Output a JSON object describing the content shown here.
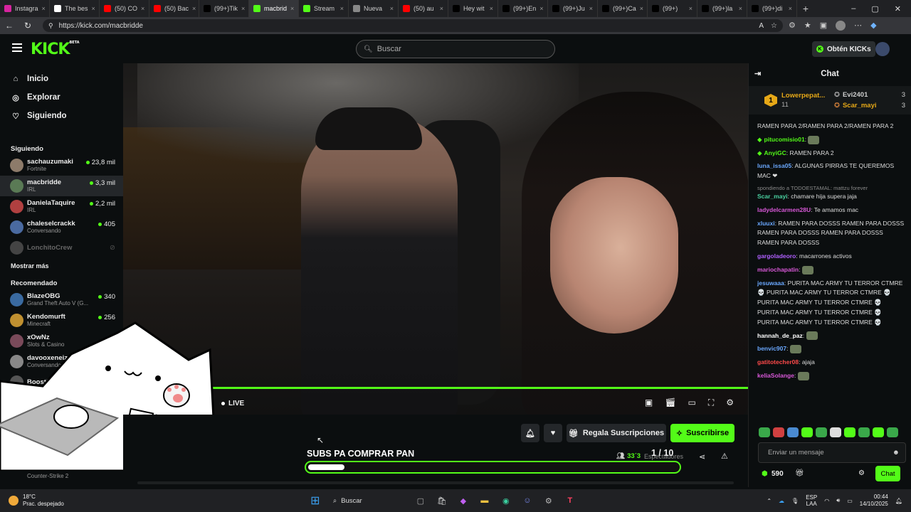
{
  "browser": {
    "tabs": [
      {
        "label": "Instagra",
        "icon_color": "#d6249f"
      },
      {
        "label": "The bes",
        "icon_color": "#ffffff"
      },
      {
        "label": "(50) CO",
        "icon_color": "#ff0000"
      },
      {
        "label": "(50) Bac",
        "icon_color": "#ff0000"
      },
      {
        "label": "(99+)Tik",
        "icon_color": "#000000"
      },
      {
        "label": "macbrid",
        "icon_color": "#53fc18"
      },
      {
        "label": "Stream",
        "icon_color": "#53fc18"
      },
      {
        "label": "Nueva",
        "icon_color": "#888888"
      },
      {
        "label": "(50) au",
        "icon_color": "#ff0000"
      },
      {
        "label": "Hey wit",
        "icon_color": "#000000"
      },
      {
        "label": "(99+)En",
        "icon_color": "#000000"
      },
      {
        "label": "(99+)Ju",
        "icon_color": "#000000"
      },
      {
        "label": "(99+)Ca",
        "icon_color": "#000000"
      },
      {
        "label": "(99+)",
        "icon_color": "#000000"
      },
      {
        "label": "(99+)la",
        "icon_color": "#000000"
      },
      {
        "label": "(99+)di",
        "icon_color": "#000000"
      }
    ],
    "active_tab": 5,
    "url": "https://kick.com/macbridde"
  },
  "kick": {
    "logo": "KICK",
    "logo_badge": "BETA",
    "search_placeholder": "Buscar",
    "get_kicks": "Obtén KICKs",
    "brand_color": "#53fc18"
  },
  "sidebar": {
    "nav": [
      {
        "label": "Inicio",
        "icon": "home-icon"
      },
      {
        "label": "Explorar",
        "icon": "compass-icon"
      },
      {
        "label": "Siguiendo",
        "icon": "heart-icon"
      }
    ],
    "following_title": "Siguiendo",
    "following": [
      {
        "name": "sachauzumaki",
        "game": "Fortnite",
        "viewers": "23,8 mil",
        "color": "#8d7b6a"
      },
      {
        "name": "macbridde",
        "game": "IRL",
        "viewers": "3,3 mil",
        "color": "#5a7a55"
      },
      {
        "name": "DanielaTaquire",
        "game": "IRL",
        "viewers": "2,2 mil",
        "color": "#b04040"
      },
      {
        "name": "chaleselcrackk",
        "game": "Conversando",
        "viewers": "405",
        "color": "#4a6aa0"
      }
    ],
    "offline": {
      "name": "LonchitoCrew"
    },
    "show_more": "Mostrar más",
    "recommended_title": "Recomendado",
    "recommended": [
      {
        "name": "BlazeOBG",
        "game": "Grand Theft Auto V (G...",
        "viewers": "340",
        "color": "#3a6aa0"
      },
      {
        "name": "Kendomurft",
        "game": "Minecraft",
        "viewers": "256",
        "color": "#c09030"
      },
      {
        "name": "xOwNz",
        "game": "Slots & Casino",
        "viewers": "",
        "color": "#7a4a5a"
      },
      {
        "name": "davooxeneiz",
        "game": "Conversando",
        "viewers": "",
        "color": "#888888"
      },
      {
        "name": "BoostlerF1",
        "game": "",
        "viewers": "",
        "color": "#555555"
      }
    ],
    "bottom_game": "Counter-Strike 2"
  },
  "player": {
    "live": "LIVE",
    "goal_title": "SUBS PA COMPRAR PAN",
    "goal_count": "1 / 10",
    "goal_progress": 0.1,
    "viewers": "33´3",
    "viewers_label": "Espectadores",
    "gift_label": "Regala Suscripciones",
    "subscribe_label": "Suscribirse"
  },
  "chat": {
    "title": "Chat",
    "pinned": {
      "top_name": "Lowerpepat...",
      "top_count": "11",
      "rank": "1",
      "users": [
        {
          "name": "Evi2401",
          "count": "3"
        },
        {
          "name": "Scar_mayi",
          "count": "3"
        }
      ]
    },
    "messages": [
      {
        "user": "",
        "color": "#ffffff",
        "text": "RAMEN PARA 2/RAMEN PARA 2/RAMEN PARA 2"
      },
      {
        "user": "pitucomisio01",
        "color": "#53fc18",
        "text": ""
      },
      {
        "user": "AnyiGC",
        "color": "#53fc18",
        "text": "RAMEN PARA 2"
      },
      {
        "user": "luna_issa05",
        "color": "#6aa8ff",
        "text": "ALGUNAS PIRRAS TE QUEREMOS MAC ❤"
      },
      {
        "user": "Scar_mayi",
        "color": "#4ad0a0",
        "text": "chamare hija supera jaja",
        "reply": "spondiendo a TODOESTAMAL: mattzu forever"
      },
      {
        "user": "ladydelcarmen28U",
        "color": "#d858d8",
        "text": "Te amamos mac"
      },
      {
        "user": "xluuxi",
        "color": "#6aa8ff",
        "text": "RAMEN PARA DOSSS RAMEN PARA DOSSS RAMEN PARA DOSSS RAMEN PARA DOSSS RAMEN PARA DOSSS"
      },
      {
        "user": "gargoladeoro",
        "color": "#b060ff",
        "text": "macarrones activos"
      },
      {
        "user": "mariochapatin",
        "color": "#d858d8",
        "text": ""
      },
      {
        "user": "jesuwaaa",
        "color": "#6aa8ff",
        "text": "PURITA MAC ARMY TU TERROR CTMRE 💀 PURITA MAC ARMY TU TERROR CTMRE 💀 PURITA MAC ARMY TU TERROR CTMRE 💀 PURITA MAC ARMY TU TERROR CTMRE 💀 PURITA MAC ARMY TU TERROR CTMRE 💀"
      },
      {
        "user": "hannah_de_paz",
        "color": "#ffffff",
        "text": ""
      },
      {
        "user": "benvic907",
        "color": "#6aa8ff",
        "text": ""
      },
      {
        "user": "gatitotecher08",
        "color": "#ff4a4a",
        "text": "ajaja"
      },
      {
        "user": "keliaSolange",
        "color": "#d858d8",
        "text": ""
      }
    ],
    "input_placeholder": "Enviar un mensaje",
    "points": "590",
    "send_label": "Chat"
  },
  "taskbar": {
    "weather_temp": "18°C",
    "weather_desc": "Prac. despejado",
    "search": "Buscar",
    "lang": "ESP",
    "lang2": "LAA",
    "time": "00:44",
    "date": "14/10/2025"
  }
}
